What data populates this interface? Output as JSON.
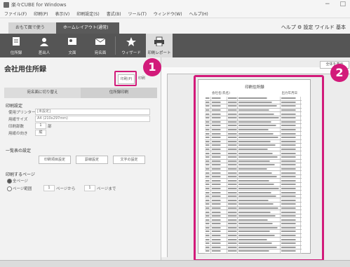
{
  "window": {
    "title": "楽々CUBE for Windows",
    "controls": [
      "−",
      "□"
    ]
  },
  "menu": [
    "ファイル(F)",
    "印刷(P)",
    "表示(V)",
    "印刷設定(S)",
    "書式(B)",
    "ツール(T)",
    "ウィンドウ(W)",
    "ヘルプ(H)"
  ],
  "ribbon_tabs": [
    {
      "label": "おもて面で使う"
    },
    {
      "label": "ホームレイアウト(通常)"
    }
  ],
  "ribbon_right": {
    "label": "ヘルプ ⚙ 設定 ワイルド 基本"
  },
  "ribbon_buttons": [
    {
      "label": "住所録",
      "icon": "address-icon"
    },
    {
      "label": "差出人",
      "icon": "sender-icon"
    },
    {
      "label": "文面",
      "icon": "design-icon"
    },
    {
      "label": "宛名面",
      "icon": "address-face-icon"
    },
    {
      "label": "ウィザード",
      "icon": "wizard-icon"
    },
    {
      "label": "印刷レポート",
      "icon": "print-report-icon"
    }
  ],
  "panel": {
    "title": "会社用住所録",
    "print_button": "印刷(P)",
    "second_button": "印刷",
    "segments": [
      "宛名面に切り替え",
      "住所録印刷"
    ],
    "section1_title": "印刷設定",
    "printer_label": "使用プリンター",
    "printer_value": "[未設定]",
    "paper_label": "用紙サイズ",
    "paper_value": "A4 (210x297mm)",
    "copies_label": "印刷部数",
    "copies_value": "1",
    "copies_unit": "部",
    "direction_label": "用紙の向き",
    "direction_value": "縦",
    "section2_title": "一覧表の設定",
    "buttons": [
      "印刷項目設定",
      "罫線設定",
      "文字の設定"
    ],
    "section3_title": "印刷するページ",
    "radio_all": "全ページ",
    "radio_range": "ページ範囲",
    "range_from": "1",
    "range_from_unit": "ページから",
    "range_to": "1",
    "range_to_unit": "ページまで"
  },
  "preview": {
    "title": "印刷住所録",
    "subheader_left": "会社名(氏名)",
    "subheader_right": "出力年月日",
    "right_button": "全体を表示",
    "rows": 40
  },
  "badges": {
    "one": "1",
    "two": "2"
  },
  "colors": {
    "highlight": "#d21a7a",
    "ribbon_bg": "#555555"
  }
}
